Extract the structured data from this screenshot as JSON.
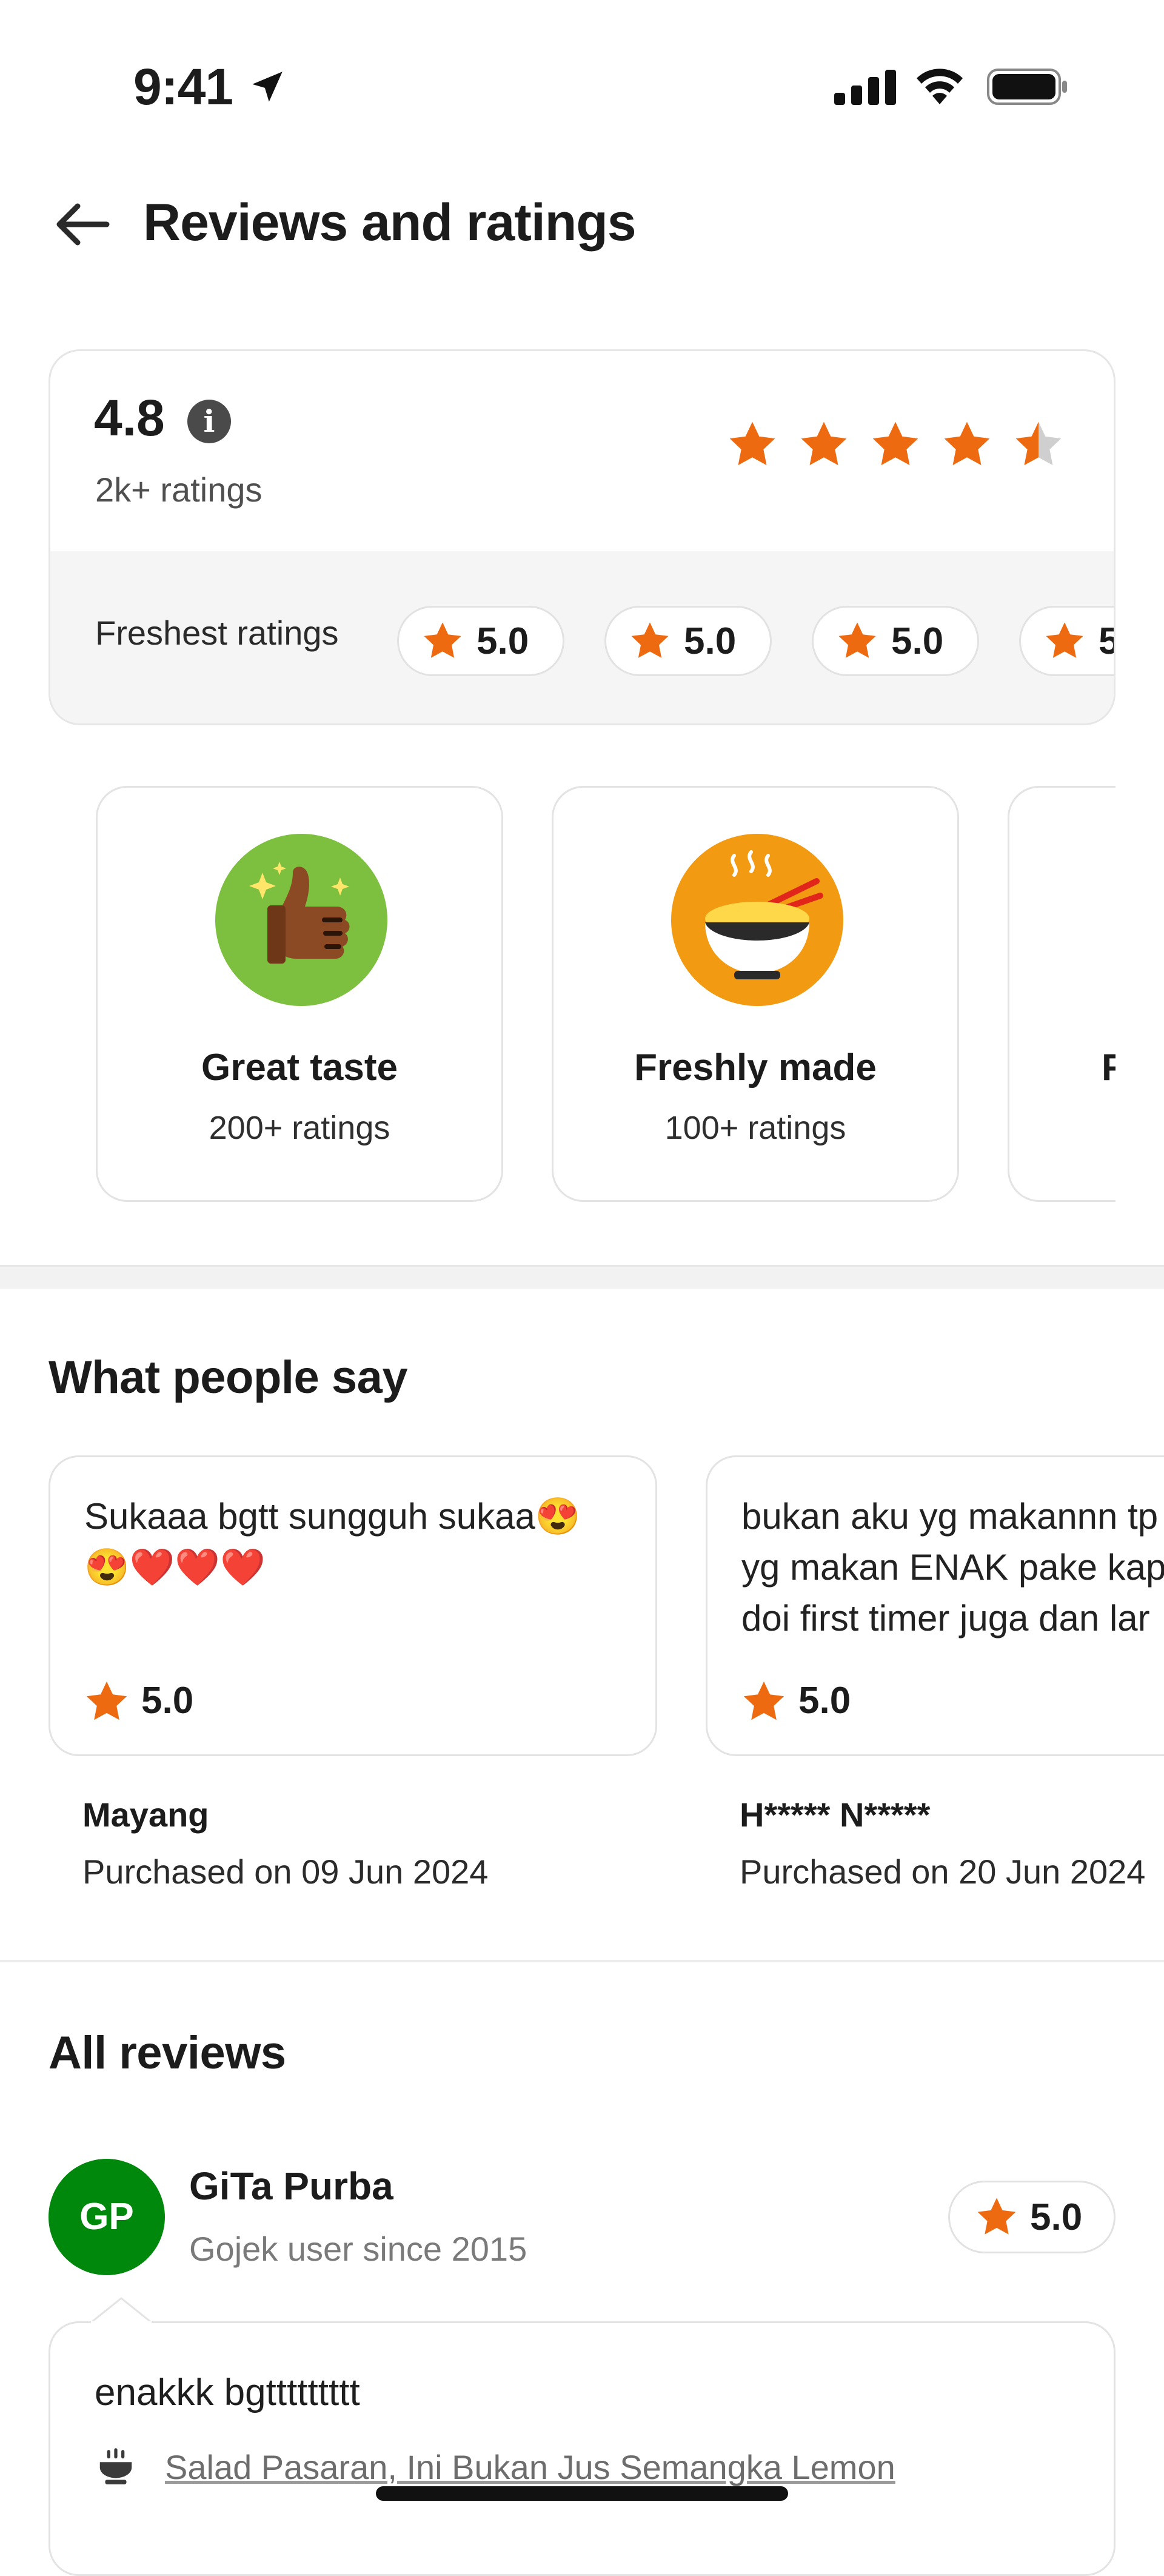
{
  "status_bar": {
    "time": "9:41"
  },
  "header": {
    "title": "Reviews and ratings"
  },
  "summary": {
    "rating": "4.8",
    "info_symbol": "i",
    "count": "2k+ ratings",
    "stars_filled": 4.5,
    "freshest_label": "Freshest ratings",
    "freshest": [
      "5.0",
      "5.0",
      "5.0",
      "5"
    ]
  },
  "highlights": [
    {
      "title": "Great taste",
      "count": "200+ ratings",
      "icon": "thumbs-up-icon"
    },
    {
      "title": "Freshly made",
      "count": "100+ ratings",
      "icon": "noodle-bowl-icon"
    },
    {
      "title": "F",
      "count": "",
      "icon": ""
    }
  ],
  "what_people_say": {
    "title": "What people say",
    "items": [
      {
        "text": "Sukaaa bgtt sungguh sukaa😍\n😍❤️❤️❤️",
        "rating": "5.0",
        "name": "Mayang",
        "date": "Purchased on 09 Jun 2024"
      },
      {
        "text": "bukan aku yg makannn tp\nyg makan ENAK pake kap\ndoi first timer juga dan lar",
        "rating": "5.0",
        "name": "H***** N*****",
        "date": "Purchased on 20 Jun 2024"
      }
    ]
  },
  "all_reviews": {
    "title": "All reviews",
    "review": {
      "initials": "GP",
      "name": "GiTa Purba",
      "since": "Gojek user since 2015",
      "rating": "5.0",
      "text": "enakkk bgttttttttt",
      "dish": "Salad Pasaran, Ini Bukan Jus Semangka Lemon"
    }
  },
  "colors": {
    "star": "#ee6a10",
    "avatar": "#00880d",
    "great_taste_bg": "#7dbf3f",
    "freshly_made_bg": "#f29a12"
  }
}
